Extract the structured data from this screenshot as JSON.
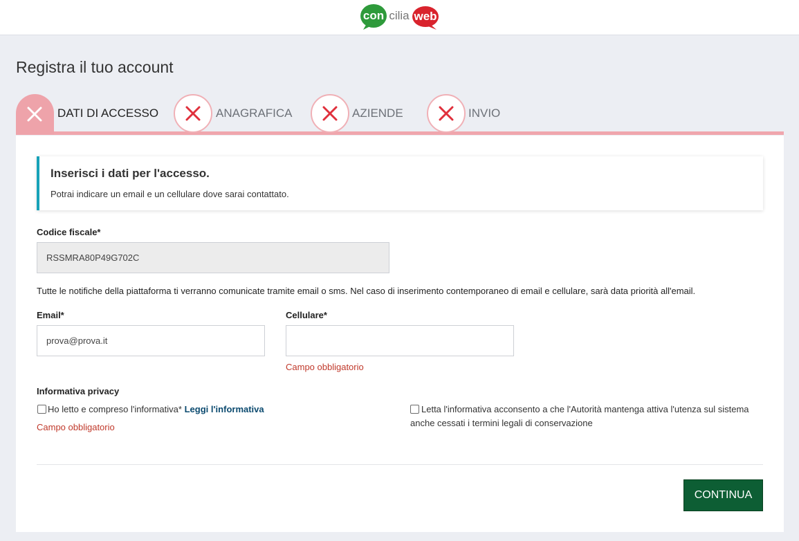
{
  "header": {
    "logo": {
      "part1": "con",
      "part2": "cilia",
      "part3": "web",
      "green": "#2e9a3b",
      "red": "#d9232d"
    }
  },
  "page": {
    "title": "Registra il tuo account"
  },
  "steps": [
    {
      "label": "DATI DI ACCESSO",
      "active": true
    },
    {
      "label": "ANAGRAFICA",
      "active": false
    },
    {
      "label": "AZIENDE",
      "active": false
    },
    {
      "label": "INVIO",
      "active": false
    }
  ],
  "notice": {
    "title": "Inserisci i dati per l'accesso.",
    "text": "Potrai indicare un email e un cellulare dove sarai contattato."
  },
  "form": {
    "codice_fiscale": {
      "label": "Codice fiscale*",
      "value": "RSSMRA80P49G702C"
    },
    "notification_text": "Tutte le notifiche della piattaforma ti verranno comunicate tramite email o sms. Nel caso di inserimento contemporaneo di email e cellulare, sarà data priorità all'email.",
    "email": {
      "label": "Email*",
      "value": "prova@prova.it"
    },
    "cellulare": {
      "label": "Cellulare*",
      "value": "",
      "error": "Campo obbligatorio"
    },
    "privacy": {
      "heading": "Informativa privacy",
      "checkbox1_label": "Ho letto e compreso l'informativa*",
      "checkbox1_link": "Leggi l'informativa",
      "checkbox1_error": "Campo obbligatorio",
      "checkbox2_line1": "Letta l'informativa acconsento a che l'Autorità mantenga attiva l'utenza sul sistema",
      "checkbox2_line2": "anche cessati i termini legali di conservazione"
    }
  },
  "actions": {
    "continue_label": "CONTINUA"
  },
  "colors": {
    "accent_teal": "#17a2b8",
    "step_pink": "#f0a6ad",
    "error_red": "#c0392b",
    "button_green": "#0d5e34"
  }
}
